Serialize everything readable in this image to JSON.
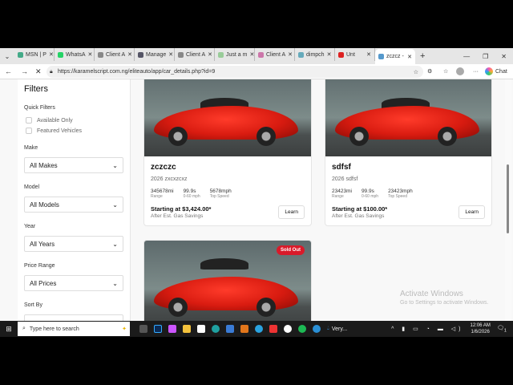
{
  "browser": {
    "tabs": [
      {
        "label": "MSN | P",
        "color": "#4a8"
      },
      {
        "label": "WhatsA",
        "color": "#25d366"
      },
      {
        "label": "Client A",
        "color": "#888"
      },
      {
        "label": "Manage",
        "color": "#556"
      },
      {
        "label": "Client A",
        "color": "#888"
      },
      {
        "label": "Just a m",
        "color": "#9c9"
      },
      {
        "label": "Client A",
        "color": "#c7a"
      },
      {
        "label": "dimpch",
        "color": "#6ab"
      },
      {
        "label": "Unt",
        "color": "#d22"
      },
      {
        "label": "zczcz -",
        "color": "#59c"
      }
    ],
    "new_tab": "+",
    "url": "https://karamelscript.com.ng/eliteauto/app/car_details.php?id=9",
    "chat_label": "Chat"
  },
  "sidebar": {
    "title": "Filters",
    "quick_filters_label": "Quick Filters",
    "checkboxes": [
      "Available Only",
      "Featured Vehicles"
    ],
    "filters": [
      {
        "label": "Make",
        "value": "All Makes"
      },
      {
        "label": "Model",
        "value": "All Models"
      },
      {
        "label": "Year",
        "value": "All Years"
      },
      {
        "label": "Price Range",
        "value": "All Prices"
      }
    ],
    "sort_label": "Sort By"
  },
  "cars": [
    {
      "name": "zczczc",
      "subtitle": "2026 zxcxzcxz",
      "range": "345678mi",
      "range_label": "Range",
      "accel": "99.9s",
      "accel_label": "0-60 mph",
      "speed": "5678mph",
      "speed_label": "Top Speed",
      "price": "Starting at $3,424.00*",
      "price_note": "After Est. Gas Savings",
      "button": "Learn"
    },
    {
      "name": "sdfsf",
      "subtitle": "2026 sdfsf",
      "range": "23423mi",
      "range_label": "Range",
      "accel": "99.9s",
      "accel_label": "0-60 mph",
      "speed": "23423mph",
      "speed_label": "Top Speed",
      "price": "Starting at $100.00*",
      "price_note": "After Est. Gas Savings",
      "button": "Learn"
    }
  ],
  "card3": {
    "badge": "Sold Out"
  },
  "watermark": {
    "title": "Activate Windows",
    "text": "Go to Settings to activate Windows."
  },
  "taskbar": {
    "search_placeholder": "Type here to search",
    "weather": "Very...",
    "time": "12:06 AM",
    "date": "1/6/2026",
    "notif": "1"
  }
}
